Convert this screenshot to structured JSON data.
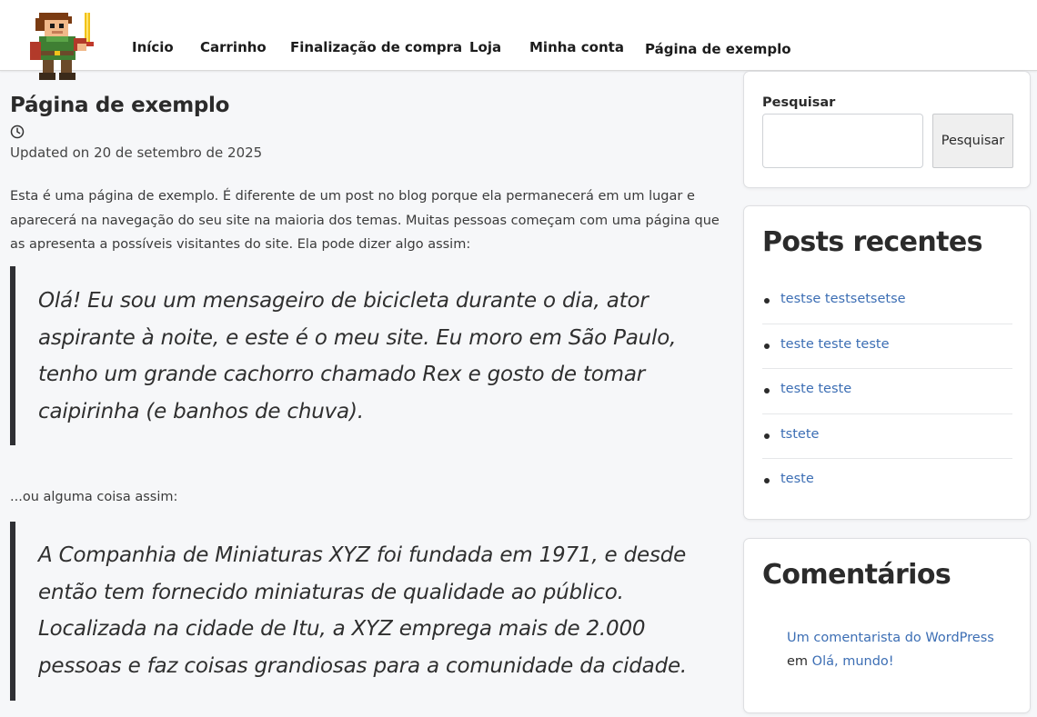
{
  "header": {
    "logo_icon": "pixel-knight-logo-icon",
    "nav": [
      "Início",
      "Carrinho",
      "Finalização de compra",
      "Loja",
      "Minha conta",
      "Página de exemplo"
    ]
  },
  "main": {
    "title": "Página de exemplo",
    "clock_icon": "clock-icon",
    "updated": "Updated on 20 de setembro de 2025",
    "intro": "Esta é uma página de exemplo. É diferente de um post no blog porque ela permanecerá em um lugar e aparecerá na navegação do seu site na maioria dos temas. Muitas pessoas começam com uma página que as apresenta a possíveis visitantes do site. Ela pode dizer algo assim:",
    "quote1": "Olá! Eu sou um mensageiro de bicicleta durante o dia, ator aspirante à noite, e este é o meu site. Eu moro em São Paulo, tenho um grande cachorro chamado Rex e gosto de tomar caipirinha (e banhos de chuva).",
    "between": "...ou alguma coisa assim:",
    "quote2": "A Companhia de Miniaturas XYZ foi fundada em 1971, e desde então tem fornecido miniaturas de qualidade ao público. Localizada na cidade de Itu, a XYZ emprega mais de 2.000 pessoas e faz coisas grandiosas para a comunidade da cidade."
  },
  "sidebar": {
    "search": {
      "label": "Pesquisar",
      "placeholder": "",
      "value": "",
      "button": "Pesquisar"
    },
    "recent": {
      "title": "Posts recentes",
      "items": [
        "testse testsetsetse",
        "teste teste teste",
        "teste teste",
        "tstete",
        "teste"
      ]
    },
    "comments": {
      "title": "Comentários",
      "author": "Um comentarista do WordPress",
      "on": "em",
      "post": "Olá, mundo!"
    }
  },
  "colors": {
    "link": "#3c6eb4",
    "quote_border": "#2f3034",
    "background": "#f6f7f9"
  }
}
